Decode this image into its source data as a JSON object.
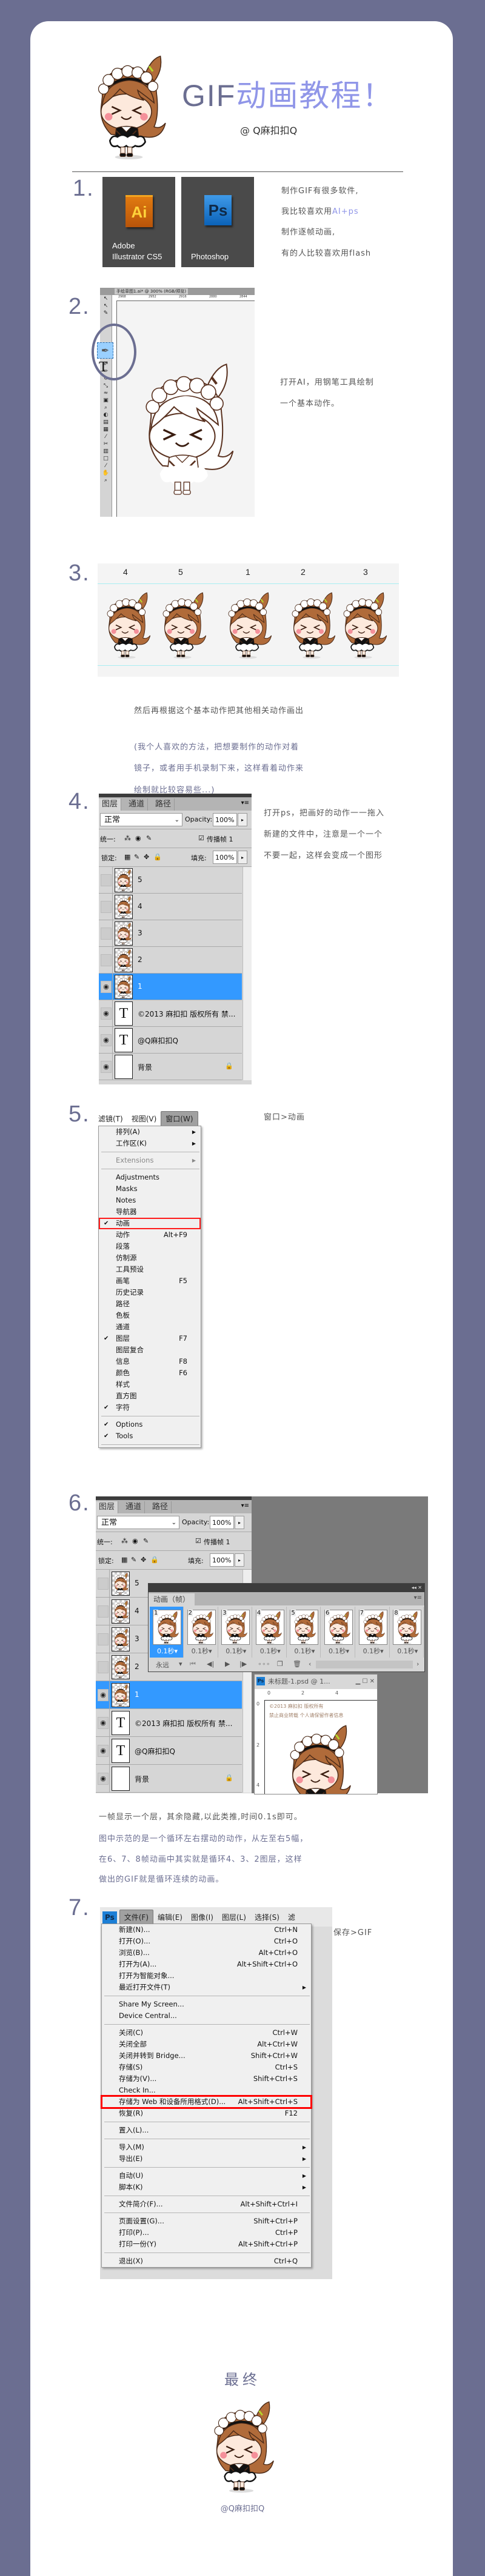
{
  "colors": {
    "background": "#6b6e91",
    "accent": "#9096e8",
    "text": "#555555",
    "selection": "#3399ff",
    "highlight_box": "#ff0000"
  },
  "header": {
    "title_latin": "GIF",
    "title_cn": "动画教程",
    "title_mark": "！",
    "author": "@ Q麻扣扣Q"
  },
  "step1": {
    "number": "1.",
    "tiles": [
      {
        "line1": "Adobe",
        "line2": "Illustrator CS5",
        "icon": "Ai"
      },
      {
        "line1": "",
        "line2": "Photoshop",
        "icon": "Ps"
      }
    ],
    "lines": [
      "制作GIF有很多软件,",
      "我比较喜欢用",
      "制作逐帧动画,",
      "有的人比较喜欢用flash"
    ],
    "highlight": "AI+ps"
  },
  "step2": {
    "number": "2.",
    "window_title": "手绘草图1.ai* @ 300% (RGB/预览)",
    "ruler": [
      "2968",
      "2952",
      "2916",
      "2880",
      "2844"
    ],
    "lines": [
      "打开AI，用钢笔工具绘制",
      "一个基本动作。"
    ]
  },
  "step3": {
    "number": "3.",
    "frame_labels": [
      "4",
      "5",
      "1",
      "2",
      "3"
    ],
    "line": "然后再根据这个基本动作把其他相关动作画出",
    "note": [
      "(我个人喜欢的方法，把想要制作的动作对着",
      "镜子，或者用手机录制下来，这样看着动作来",
      "绘制就比较容易些...)"
    ]
  },
  "layers_panel": {
    "tabs": [
      "图层",
      "通道",
      "路径"
    ],
    "blend_mode": "正常",
    "opacity_label": "Opacity:",
    "opacity": "100%",
    "unify_label": "统一:",
    "propagate_label": "传播帧 1",
    "lock_label": "锁定:",
    "fill_label": "填充:",
    "fill": "100%",
    "layers": [
      {
        "name": "5",
        "type": "image",
        "visible": false,
        "selected": false
      },
      {
        "name": "4",
        "type": "image",
        "visible": false,
        "selected": false
      },
      {
        "name": "3",
        "type": "image",
        "visible": false,
        "selected": false
      },
      {
        "name": "2",
        "type": "image",
        "visible": false,
        "selected": false
      },
      {
        "name": "1",
        "type": "image",
        "visible": true,
        "selected": true
      },
      {
        "name": "©2013 麻扣扣 版权所有 禁...",
        "type": "text",
        "visible": true,
        "selected": false
      },
      {
        "name": "@Q麻扣扣Q",
        "type": "text",
        "visible": true,
        "selected": false
      },
      {
        "name": "背景",
        "type": "background",
        "visible": true,
        "selected": false,
        "locked": true
      }
    ]
  },
  "step4": {
    "number": "4.",
    "lines": [
      "打开ps，把画好的动作一一拖入",
      "新建的文件中，注意是一个一个",
      "不要一起，这样会变成一个图形"
    ]
  },
  "step5": {
    "number": "5.",
    "menubar": [
      "滤镜(T)",
      "视图(V)",
      "窗口(W)"
    ],
    "instruction": "窗口>动画",
    "menu": [
      {
        "label": "排列(A)",
        "sub": true
      },
      {
        "label": "工作区(K)",
        "sub": true
      },
      {
        "sep": true
      },
      {
        "label": "Extensions",
        "sub": true,
        "disabled": true
      },
      {
        "sep": true
      },
      {
        "label": "Adjustments"
      },
      {
        "label": "Masks"
      },
      {
        "label": "Notes"
      },
      {
        "label": "导航器"
      },
      {
        "label": "动画",
        "checked": true,
        "boxed": true
      },
      {
        "label": "动作",
        "shortcut": "Alt+F9"
      },
      {
        "label": "段落"
      },
      {
        "label": "仿制源"
      },
      {
        "label": "工具预设"
      },
      {
        "label": "画笔",
        "shortcut": "F5"
      },
      {
        "label": "历史记录"
      },
      {
        "label": "路径"
      },
      {
        "label": "色板"
      },
      {
        "label": "通道"
      },
      {
        "label": "图层",
        "shortcut": "F7",
        "checked": true
      },
      {
        "label": "图层复合"
      },
      {
        "label": "信息",
        "shortcut": "F8"
      },
      {
        "label": "颜色",
        "shortcut": "F6"
      },
      {
        "label": "样式"
      },
      {
        "label": "直方图"
      },
      {
        "label": "字符",
        "checked": true
      },
      {
        "sep": true
      },
      {
        "label": "Options",
        "checked": true
      },
      {
        "label": "Tools",
        "checked": true
      },
      {
        "sep": true
      }
    ]
  },
  "step6": {
    "number": "6.",
    "animation_panel": {
      "tab": "动画（帧）",
      "frames": [
        {
          "n": "1",
          "delay": "0.1秒"
        },
        {
          "n": "2",
          "delay": "0.1秒"
        },
        {
          "n": "3",
          "delay": "0.1秒"
        },
        {
          "n": "4",
          "delay": "0.1秒"
        },
        {
          "n": "5",
          "delay": "0.1秒"
        },
        {
          "n": "6",
          "delay": "0.1秒"
        },
        {
          "n": "7",
          "delay": "0.1秒"
        },
        {
          "n": "8",
          "delay": "0.1秒"
        }
      ],
      "selected_frame": 1,
      "loop": "永远"
    },
    "document": {
      "title": "未标题-1.psd @ 1...",
      "ruler_h": [
        "0",
        "2",
        "4"
      ],
      "ruler_v": [
        "0",
        "2",
        "4"
      ],
      "copyright": "©2013 麻扣扣 版权所有",
      "notice": "禁止商业转载 个人请保留作者信息"
    },
    "lines": [
      "一帧显示一个层，其余隐藏,以此类推,时间0.1s即可。",
      "图中示范的是一个循环左右摆动的动作，从左至右5幅，",
      "在6、7、8帧动画中其实就是循环4、3、2图层，这样",
      "做出的GIF就是循环连续的动画。"
    ]
  },
  "step7": {
    "number": "7.",
    "menubar": [
      "文件(F)",
      "编辑(E)",
      "图像(I)",
      "图层(L)",
      "选择(S)",
      "滤"
    ],
    "app_icon": "Ps",
    "instruction": "保存>GIF",
    "menu": [
      {
        "label": "新建(N)...",
        "shortcut": "Ctrl+N"
      },
      {
        "label": "打开(O)...",
        "shortcut": "Ctrl+O"
      },
      {
        "label": "浏览(B)...",
        "shortcut": "Alt+Ctrl+O"
      },
      {
        "label": "打开为(A)...",
        "shortcut": "Alt+Shift+Ctrl+O"
      },
      {
        "label": "打开为智能对象..."
      },
      {
        "label": "最近打开文件(T)",
        "sub": true
      },
      {
        "sep": true
      },
      {
        "label": "Share My Screen..."
      },
      {
        "label": "Device Central..."
      },
      {
        "sep": true
      },
      {
        "label": "关闭(C)",
        "shortcut": "Ctrl+W"
      },
      {
        "label": "关闭全部",
        "shortcut": "Alt+Ctrl+W"
      },
      {
        "label": "关闭并转到 Bridge...",
        "shortcut": "Shift+Ctrl+W"
      },
      {
        "label": "存储(S)",
        "shortcut": "Ctrl+S"
      },
      {
        "label": "存储为(V)...",
        "shortcut": "Shift+Ctrl+S"
      },
      {
        "label": "Check In..."
      },
      {
        "label": "存储为 Web 和设备所用格式(D)...",
        "shortcut": "Alt+Shift+Ctrl+S",
        "boxed": true
      },
      {
        "label": "恢复(R)",
        "shortcut": "F12"
      },
      {
        "sep": true
      },
      {
        "label": "置入(L)..."
      },
      {
        "sep": true
      },
      {
        "label": "导入(M)",
        "sub": true
      },
      {
        "label": "导出(E)",
        "sub": true
      },
      {
        "sep": true
      },
      {
        "label": "自动(U)",
        "sub": true
      },
      {
        "label": "脚本(K)",
        "sub": true
      },
      {
        "sep": true
      },
      {
        "label": "文件简介(F)...",
        "shortcut": "Alt+Shift+Ctrl+I"
      },
      {
        "sep": true
      },
      {
        "label": "页面设置(G)...",
        "shortcut": "Shift+Ctrl+P"
      },
      {
        "label": "打印(P)...",
        "shortcut": "Ctrl+P"
      },
      {
        "label": "打印一份(Y)",
        "shortcut": "Alt+Shift+Ctrl+P"
      },
      {
        "sep": true
      },
      {
        "label": "退出(X)",
        "shortcut": "Ctrl+Q"
      }
    ]
  },
  "final": {
    "title": "最终",
    "author": "@Q麻扣扣Q"
  }
}
